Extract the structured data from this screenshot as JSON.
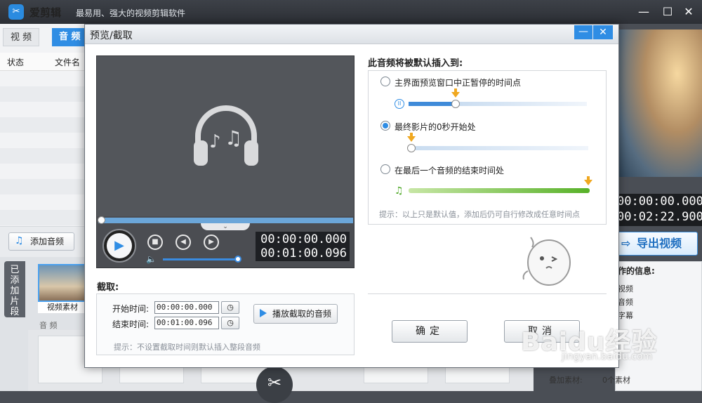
{
  "app": {
    "logo_glyph": "✂",
    "name": "爱剪辑",
    "slogan": "最易用、强大的视频剪辑软件",
    "min_glyph": "—",
    "max_glyph": "☐",
    "close_glyph": "✕"
  },
  "tabs": {
    "video": "视 频",
    "audio": "音 频"
  },
  "list_headers": {
    "status": "状态",
    "filename": "文件名"
  },
  "add_audio_label": "添加音频",
  "clips": {
    "tab_label": "已添加片段",
    "clip_label": "视频素材",
    "track_label": "音 频"
  },
  "right": {
    "timecode_current": "00:00:00.000",
    "timecode_total": "00:02:22.900",
    "export_label": "导出视频",
    "info_title": "作的信息:",
    "info_lines": [
      "视频",
      "音频",
      "字幕"
    ],
    "overlay_label": "叠加素材:",
    "overlay_value": "0个素材"
  },
  "dialog": {
    "title": "预览/截取",
    "min_glyph": "—",
    "close_glyph": "✕",
    "player": {
      "time_current": "00:00:00.000",
      "time_total": "00:01:00.096",
      "expand_glyph": "⌄",
      "play_glyph": "▶",
      "stop_glyph": "■",
      "prev_glyph": "◀",
      "next_glyph": "▶",
      "volume_glyph": "🔈"
    },
    "cut": {
      "section_label": "截取:",
      "start_label": "开始时间:",
      "start_value": "00:00:00.000",
      "end_label": "结束时间:",
      "end_value": "00:01:00.096",
      "clock_glyph": "◷",
      "play_cut_label": "播放截取的音频",
      "hint": "提示：不设置截取时间则默认插入整段音频"
    },
    "insert": {
      "title": "此音频将被默认插入到:",
      "option1": "主界面预览窗口中正暂停的时间点",
      "option2": "最终影片的0秒开始处",
      "option3": "在最后一个音频的结束时间处",
      "selected_option": 2,
      "pause_glyph": "II",
      "note_glyph": "♫",
      "hint": "提示：以上只是默认值，添加后仍可自行修改成任意时间点"
    },
    "ok_label": "确定",
    "cancel_label": "取消"
  },
  "watermark": {
    "main": "Baidu经验",
    "sub": "jingyan.baidu.com"
  }
}
